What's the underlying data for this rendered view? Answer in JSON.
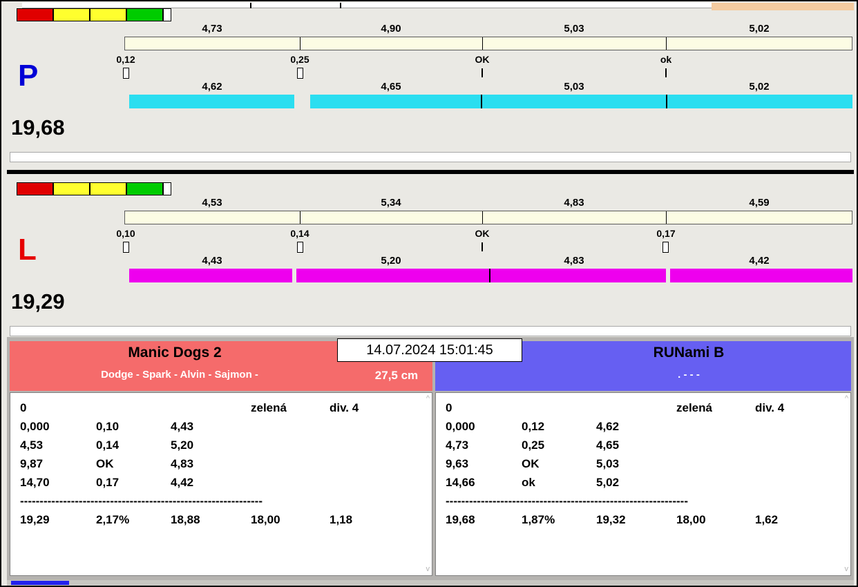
{
  "colors": {
    "lane_p_run_bar": "#2BDEF0",
    "lane_l_run_bar": "#EE00EE",
    "segment_bar": "#FCFCE4",
    "team_left_header": "#F56B6B",
    "team_right_header": "#665FF2",
    "light_red": "#E00000",
    "light_yellow": "#FFFF2E",
    "light_green": "#00CC00",
    "lane_p_letter": "#0000D6",
    "lane_l_letter": "#E60000"
  },
  "icons": {
    "scroll_up": "^",
    "scroll_down": "v"
  },
  "center": {
    "timestamp": "14.07.2024 15:01:45",
    "hurdle_height": "27,5 cm"
  },
  "lanes": [
    {
      "letter": "P",
      "total": "19,68",
      "top_values": [
        "4,73",
        "4,90",
        "5,03",
        "5,02"
      ],
      "marks": [
        "0,12",
        "0,25",
        "OK",
        "ok"
      ],
      "bottom_values": [
        "4,62",
        "4,65",
        "5,03",
        "5,02"
      ]
    },
    {
      "letter": "L",
      "total": "19,29",
      "top_values": [
        "4,53",
        "5,34",
        "4,83",
        "4,59"
      ],
      "marks": [
        "0,10",
        "0,14",
        "OK",
        "0,17"
      ],
      "bottom_values": [
        "4,43",
        "5,20",
        "4,83",
        "4,42"
      ]
    }
  ],
  "teams": [
    {
      "name": "Manic Dogs 2",
      "lineup": "Dodge - Spark - Alvin - Sajmon -",
      "table": {
        "lead": "0",
        "color_label": "zelená",
        "division": "div. 4",
        "splits": [
          [
            "0,000",
            "0,10",
            "4,43"
          ],
          [
            "4,53",
            "0,14",
            "5,20"
          ],
          [
            "9,87",
            "OK",
            "4,83"
          ],
          [
            "14,70",
            "0,17",
            "4,42"
          ]
        ],
        "separator": "--------------------------------------------------------------",
        "totals": [
          "19,29",
          "2,17%",
          "18,88",
          "18,00",
          "1,18"
        ]
      }
    },
    {
      "name": "RUNami B",
      "lineup": ". -  - -",
      "table": {
        "lead": "0",
        "color_label": "zelená",
        "division": "div. 4",
        "splits": [
          [
            "0,000",
            "0,12",
            "4,62"
          ],
          [
            "4,73",
            "0,25",
            "4,65"
          ],
          [
            "9,63",
            "OK",
            "5,03"
          ],
          [
            "14,66",
            "ok",
            "5,02"
          ]
        ],
        "separator": "--------------------------------------------------------------",
        "totals": [
          "19,68",
          "1,87%",
          "19,32",
          "18,00",
          "1,62"
        ]
      }
    }
  ]
}
